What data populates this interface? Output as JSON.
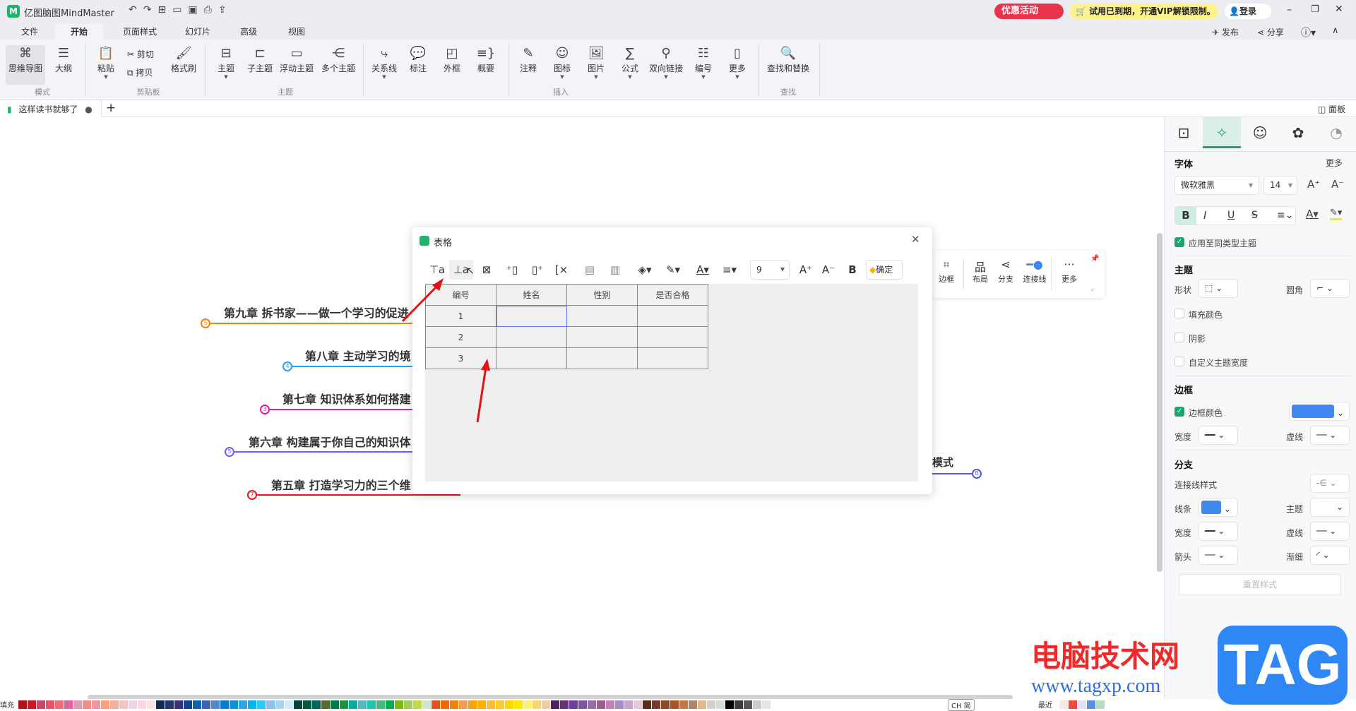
{
  "app": {
    "title": "亿图脑图MindMaster",
    "promo": "优惠活动",
    "vip_notice": "试用已到期，开通VIP解锁限制。",
    "login": "登录",
    "publish": "发布",
    "share": "分享"
  },
  "menu_tabs": [
    "文件",
    "开始",
    "页面样式",
    "幻灯片",
    "高级",
    "视图"
  ],
  "ribbon": {
    "buttons": [
      {
        "label": "思维导图",
        "icon": "mindmap-icon"
      },
      {
        "label": "大纲",
        "icon": "outline-icon"
      },
      {
        "label": "粘贴",
        "icon": "paste-icon"
      },
      {
        "label": "剪切",
        "icon": "cut-icon"
      },
      {
        "label": "拷贝",
        "icon": "copy-icon"
      },
      {
        "label": "格式刷",
        "icon": "format-brush-icon"
      },
      {
        "label": "主题",
        "icon": "topic-icon"
      },
      {
        "label": "子主题",
        "icon": "subtopic-icon"
      },
      {
        "label": "浮动主题",
        "icon": "float-topic-icon"
      },
      {
        "label": "多个主题",
        "icon": "multi-topic-icon"
      },
      {
        "label": "关系线",
        "icon": "relation-icon"
      },
      {
        "label": "标注",
        "icon": "callout-icon"
      },
      {
        "label": "外框",
        "icon": "boundary-icon"
      },
      {
        "label": "概要",
        "icon": "summary-icon"
      },
      {
        "label": "注释",
        "icon": "note-icon"
      },
      {
        "label": "图标",
        "icon": "mark-icon"
      },
      {
        "label": "图片",
        "icon": "image-icon"
      },
      {
        "label": "公式",
        "icon": "formula-icon"
      },
      {
        "label": "双向链接",
        "icon": "bilink-icon"
      },
      {
        "label": "编号",
        "icon": "numbering-icon"
      },
      {
        "label": "更多",
        "icon": "more-icon"
      },
      {
        "label": "查找和替换",
        "icon": "find-replace-icon"
      }
    ],
    "groups": [
      "模式",
      "剪贴板",
      "主题",
      "插入",
      "查找"
    ]
  },
  "doc_tab": {
    "name": "这样读书就够了",
    "add": "+",
    "panel_toggle": "面板"
  },
  "mindmap": {
    "nodes": [
      {
        "text": "第九章 拆书家——做一个学习的促进",
        "badge": "5",
        "color": "#f5820f"
      },
      {
        "text": "第八章 主动学习的境",
        "badge": "4",
        "color": "#22a6f2"
      },
      {
        "text": "第七章 知识体系如何搭建",
        "badge": "3",
        "color": "#e0209a"
      },
      {
        "text": "第六章 构建属于你自己的知识体",
        "badge": "5",
        "color": "#7b5cf0"
      },
      {
        "text": "第五章 打造学习力的三个维",
        "badge": "7",
        "color": "#e8141e"
      },
      {
        "text": "模式",
        "badge": "0",
        "color": "#5a56e0"
      }
    ]
  },
  "dialog": {
    "title": "表格",
    "font_size": "9",
    "confirm": "确定",
    "toolbar_icons": [
      "insert-row-above-icon",
      "insert-row-below-icon",
      "delete-row-icon",
      "insert-col-left-icon",
      "insert-col-right-icon",
      "delete-col-icon",
      "merge-cells-icon",
      "split-cells-icon",
      "fill-color-icon",
      "border-color-icon",
      "font-color-icon",
      "align-icon",
      "font-increase-icon",
      "font-decrease-icon",
      "bold-icon"
    ],
    "table": {
      "headers": [
        "编号",
        "姓名",
        "性别",
        "是否合格"
      ],
      "rows": [
        [
          "1",
          "",
          "",
          ""
        ],
        [
          "2",
          "",
          "",
          ""
        ],
        [
          "3",
          "",
          "",
          ""
        ]
      ]
    }
  },
  "float_toolbar": {
    "items": [
      "边框",
      "布局",
      "分支",
      "连接线",
      "更多"
    ]
  },
  "panel": {
    "font_section": "字体",
    "more": "更多",
    "font_family": "微软雅黑",
    "font_size": "14",
    "apply_same": "应用至同类型主题",
    "topic_section": "主题",
    "shape": "形状",
    "corner": "圆角",
    "fill_color": "填充颜色",
    "shadow": "阴影",
    "custom_width": "自定义主题宽度",
    "border_section": "边框",
    "border_color": "边框颜色",
    "border_color_value": "#3f88f0",
    "width": "宽度",
    "dash": "虚线",
    "branch_section": "分支",
    "connector_style": "连接线样式",
    "line": "线条",
    "line_color": "#3f88f0",
    "topic": "主题",
    "arrow": "箭头",
    "taper": "渐细",
    "reset": "重置样式"
  },
  "bottom": {
    "fill_label": "填充",
    "recent_label": "最近",
    "ime": "CH 简",
    "palette": [
      "#b5111b",
      "#d7141e",
      "#c9476b",
      "#e75467",
      "#ef6d76",
      "#e361a0",
      "#e09bb8",
      "#ee8d8a",
      "#f095a4",
      "#fba27c",
      "#f3b09f",
      "#f6c3c3",
      "#e9d5e6",
      "#fbd5e3",
      "#fbe3e6",
      "#15284f",
      "#213870",
      "#3d2e78",
      "#10458b",
      "#0a66a8",
      "#3e64b0",
      "#5787c9",
      "#0a7ccc",
      "#0c93d6",
      "#2ba9e1",
      "#03b4ee",
      "#2ec8f5",
      "#8bc2ea",
      "#a5d8ee",
      "#d2ebf5",
      "#00473a",
      "#005c3d",
      "#00655f",
      "#566a2e",
      "#007b4a",
      "#1a9640",
      "#00ae9c",
      "#50bcc0",
      "#1fc6a8",
      "#4ab97f",
      "#00b050",
      "#7fba11",
      "#a3cc5b",
      "#c2d94a",
      "#cde7cb",
      "#e4521c",
      "#ee6a00",
      "#f28300",
      "#f49a52",
      "#f4a600",
      "#ffb000",
      "#fcbb39",
      "#ffcd2b",
      "#ffd800",
      "#ffe800",
      "#fff07a",
      "#fad570",
      "#f0cc9e",
      "#4a245f",
      "#6e2f78",
      "#6c3fa0",
      "#7b549f",
      "#9b6aa6",
      "#9e5b92",
      "#c77fb4",
      "#a58ecb",
      "#c7a8cd",
      "#e8c6e0",
      "#5e2b1a",
      "#7a3a29",
      "#8c4a22",
      "#a7542a",
      "#bf7a45",
      "#b08566",
      "#debc8a",
      "#d4d0c8",
      "#d1ded4",
      "#000000",
      "#3d3a39",
      "#595757",
      "#cccccc",
      "#e5e5e5"
    ],
    "recent": [
      "#fde6e6",
      "#f0473e",
      "#dde3f7",
      "#5b8fe0",
      "#b9dcc1"
    ]
  },
  "watermark": {
    "cn": "电脑技术网",
    "url": "www.tagxp.com",
    "logo": "TAG"
  }
}
